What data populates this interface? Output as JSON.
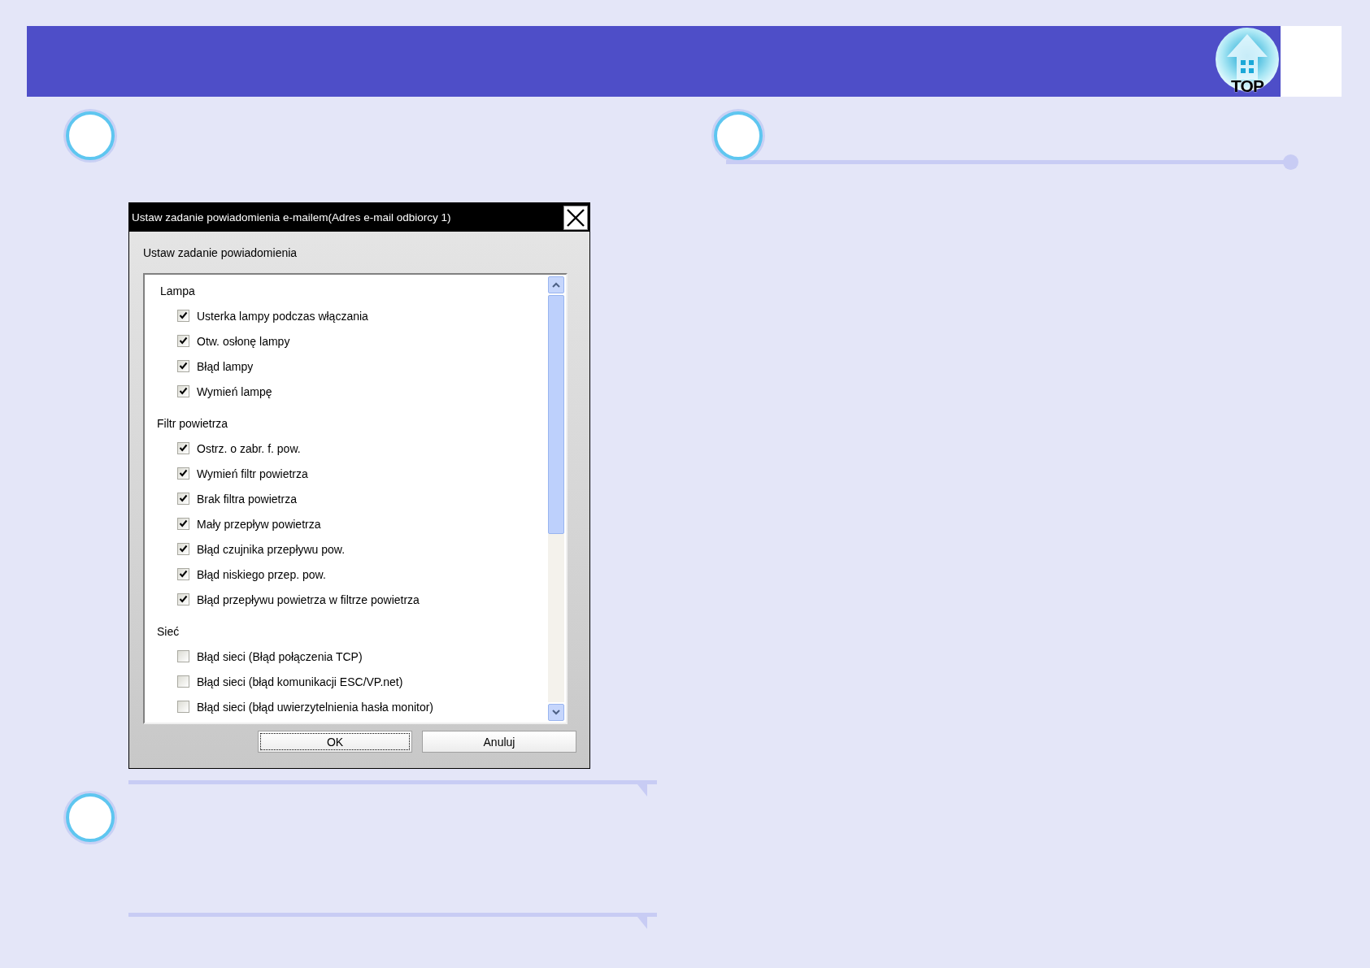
{
  "header": {
    "top_button": {
      "label": "TOP"
    }
  },
  "dialog": {
    "title": "Ustaw zadanie powiadomienia e-mailem(Adres e-mail odbiorcy 1)",
    "section_label": "Ustaw zadanie powiadomienia",
    "groups": [
      {
        "label": "Lampa",
        "items": [
          {
            "label": "Usterka lampy podczas włączania",
            "checked": true
          },
          {
            "label": "Otw. osłonę lampy",
            "checked": true
          },
          {
            "label": "Błąd lampy",
            "checked": true
          },
          {
            "label": "Wymień lampę",
            "checked": true
          }
        ]
      },
      {
        "label": "Filtr powietrza",
        "items": [
          {
            "label": "Ostrz. o zabr. f. pow.",
            "checked": true
          },
          {
            "label": "Wymień filtr powietrza",
            "checked": true
          },
          {
            "label": "Brak filtra powietrza",
            "checked": true
          },
          {
            "label": "Mały przepływ powietrza",
            "checked": true
          },
          {
            "label": "Błąd czujnika przepływu pow.",
            "checked": true
          },
          {
            "label": "Błąd niskiego przep. pow.",
            "checked": true
          },
          {
            "label": "Błąd przepływu powietrza w filtrze powietrza",
            "checked": true
          }
        ]
      },
      {
        "label": "Sieć",
        "items": [
          {
            "label": "Błąd sieci (Błąd połączenia TCP)",
            "checked": false
          },
          {
            "label": "Błąd sieci (błąd komunikacji ESC/VP.net)",
            "checked": false
          },
          {
            "label": "Błąd sieci (błąd uwierzytelnienia hasła monitor)",
            "checked": false
          }
        ]
      }
    ],
    "buttons": [
      {
        "label": "OK",
        "focused": true
      },
      {
        "label": "Anuluj",
        "focused": false
      }
    ]
  }
}
